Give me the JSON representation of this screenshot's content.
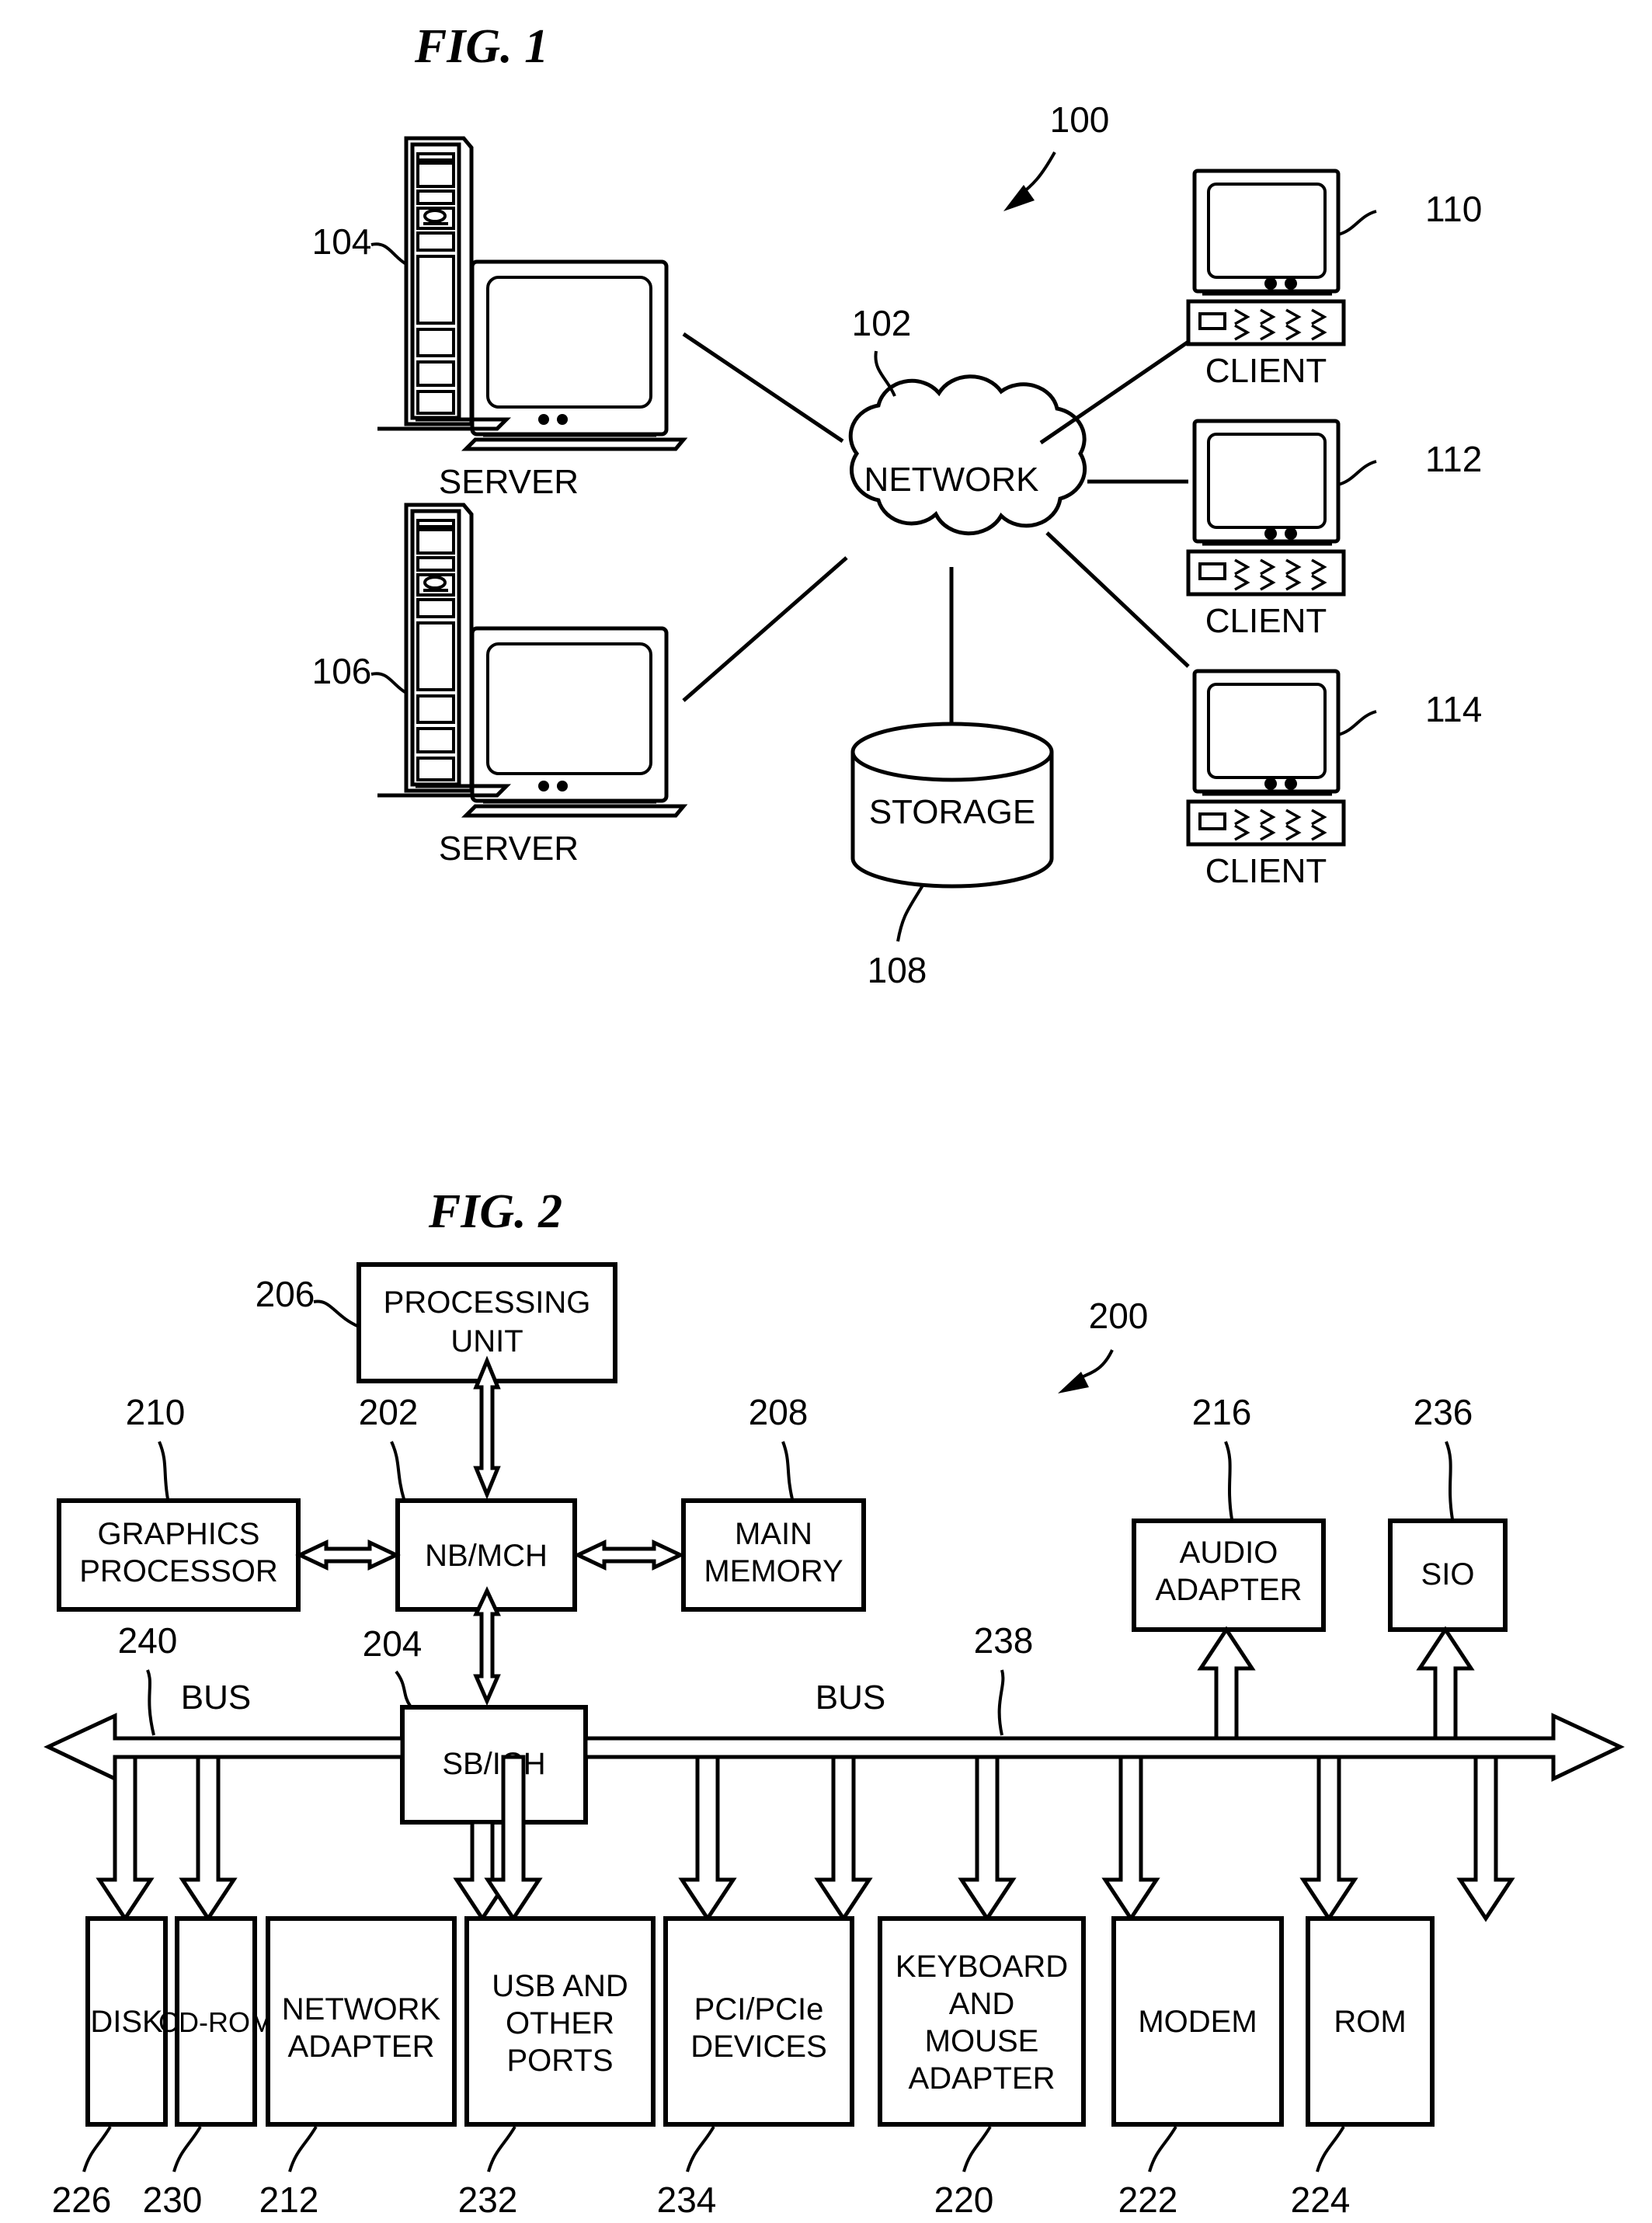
{
  "figures": [
    {
      "id": "fig1",
      "title": "FIG. 1",
      "system_ref": "100",
      "nodes": {
        "network": {
          "label": "NETWORK",
          "ref": "102",
          "shape": "cloud-icon"
        },
        "storage": {
          "label": "STORAGE",
          "ref": "108",
          "shape": "cylinder-icon"
        },
        "server_top": {
          "label": "SERVER",
          "ref": "104",
          "shape": "server-icon"
        },
        "server_bottom": {
          "label": "SERVER",
          "ref": "106",
          "shape": "server-icon"
        },
        "client_top": {
          "label": "CLIENT",
          "ref": "110",
          "shape": "client-computer-icon"
        },
        "client_middle": {
          "label": "CLIENT",
          "ref": "112",
          "shape": "client-computer-icon"
        },
        "client_bottom": {
          "label": "CLIENT",
          "ref": "114",
          "shape": "client-computer-icon"
        }
      }
    },
    {
      "id": "fig2",
      "title": "FIG. 2",
      "system_ref": "200",
      "blocks": [
        {
          "key": "processing_unit",
          "label": "PROCESSING UNIT",
          "lines": [
            "PROCESSING",
            "UNIT"
          ],
          "ref": "206"
        },
        {
          "key": "graphics_processor",
          "label": "GRAPHICS PROCESSOR",
          "lines": [
            "GRAPHICS",
            "PROCESSOR"
          ],
          "ref": "210"
        },
        {
          "key": "nb_mch",
          "label": "NB/MCH",
          "lines": [
            "NB/MCH"
          ],
          "ref": "202"
        },
        {
          "key": "main_memory",
          "label": "MAIN MEMORY",
          "lines": [
            "MAIN",
            "MEMORY"
          ],
          "ref": "208"
        },
        {
          "key": "audio_adapter",
          "label": "AUDIO ADAPTER",
          "lines": [
            "AUDIO",
            "ADAPTER"
          ],
          "ref": "216"
        },
        {
          "key": "sio",
          "label": "SIO",
          "lines": [
            "SIO"
          ],
          "ref": "236"
        },
        {
          "key": "sb_ich",
          "label": "SB/ICH",
          "lines": [
            "SB/ICH"
          ],
          "ref": "204"
        },
        {
          "key": "disk",
          "label": "DISK",
          "lines": [
            "DISK"
          ],
          "ref": "226"
        },
        {
          "key": "cd_rom",
          "label": "CD-ROM",
          "lines": [
            "CD-ROM"
          ],
          "ref": "230"
        },
        {
          "key": "network_adapter",
          "label": "NETWORK ADAPTER",
          "lines": [
            "NETWORK",
            "ADAPTER"
          ],
          "ref": "212"
        },
        {
          "key": "usb_ports",
          "label": "USB AND OTHER PORTS",
          "lines": [
            "USB AND",
            "OTHER",
            "PORTS"
          ],
          "ref": "232"
        },
        {
          "key": "pci_devices",
          "label": "PCI/PCIe DEVICES",
          "lines": [
            "PCI/PCIe",
            "DEVICES"
          ],
          "ref": "234"
        },
        {
          "key": "keyboard_mouse_adapter",
          "label": "KEYBOARD AND MOUSE ADAPTER",
          "lines": [
            "KEYBOARD",
            "AND",
            "MOUSE",
            "ADAPTER"
          ],
          "ref": "220"
        },
        {
          "key": "modem",
          "label": "MODEM",
          "lines": [
            "MODEM"
          ],
          "ref": "222"
        },
        {
          "key": "rom",
          "label": "ROM",
          "lines": [
            "ROM"
          ],
          "ref": "224"
        }
      ],
      "buses": [
        {
          "key": "bus_left",
          "label": "BUS",
          "ref": "240"
        },
        {
          "key": "bus_right",
          "label": "BUS",
          "ref": "238"
        }
      ]
    }
  ],
  "colors": {
    "ink": "#000000",
    "paper": "#ffffff"
  }
}
